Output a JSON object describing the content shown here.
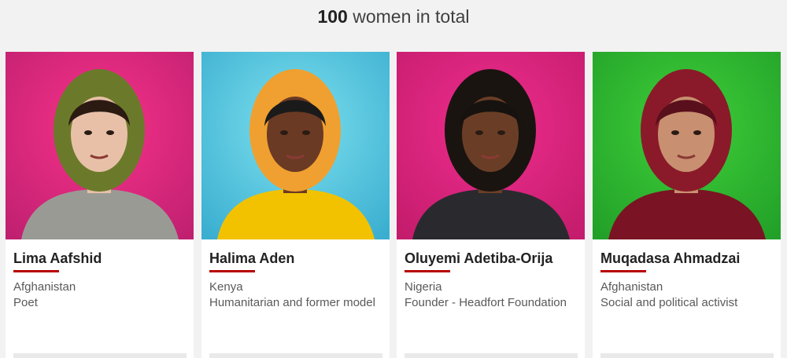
{
  "heading": {
    "count": "100",
    "rest": " women in total"
  },
  "cards": [
    {
      "name": "Lima Aafshid",
      "country": "Afghanistan",
      "role": "Poet",
      "photo_alt": "Portrait of Lima Aafshid",
      "bg": [
        "#f7328a",
        "#c02070"
      ],
      "scarf": "#6b7a2a",
      "skin": "#e8c0a8",
      "hair": "#2a1a12",
      "clothes": "#9a9a95"
    },
    {
      "name": "Halima Aden",
      "country": "Kenya",
      "role": "Humanitarian and former model",
      "photo_alt": "Portrait of Halima Aden",
      "bg": [
        "#7de0ee",
        "#3aaed0"
      ],
      "scarf": "#f0a030",
      "skin": "#6a3a24",
      "hair": "#1a1a1a",
      "clothes": "#f2c200"
    },
    {
      "name": "Oluyemi Adetiba-Orija",
      "country": "Nigeria",
      "role": "Founder - Headfort Foundation",
      "photo_alt": "Portrait of Oluyemi Adetiba-Orija",
      "bg": [
        "#ee2d8e",
        "#c41c6c"
      ],
      "scarf": "#1a1410",
      "skin": "#6a3e26",
      "hair": "#161210",
      "clothes": "#2a2a2e"
    },
    {
      "name": "Muqadasa Ahmadzai",
      "country": "Afghanistan",
      "role": "Social and political activist",
      "photo_alt": "Portrait of Muqadasa Ahmadzai",
      "bg": [
        "#3fcf3a",
        "#22a028"
      ],
      "scarf": "#8a1a2a",
      "skin": "#c89070",
      "hair": "#5a0f1c",
      "clothes": "#7a1424"
    }
  ]
}
